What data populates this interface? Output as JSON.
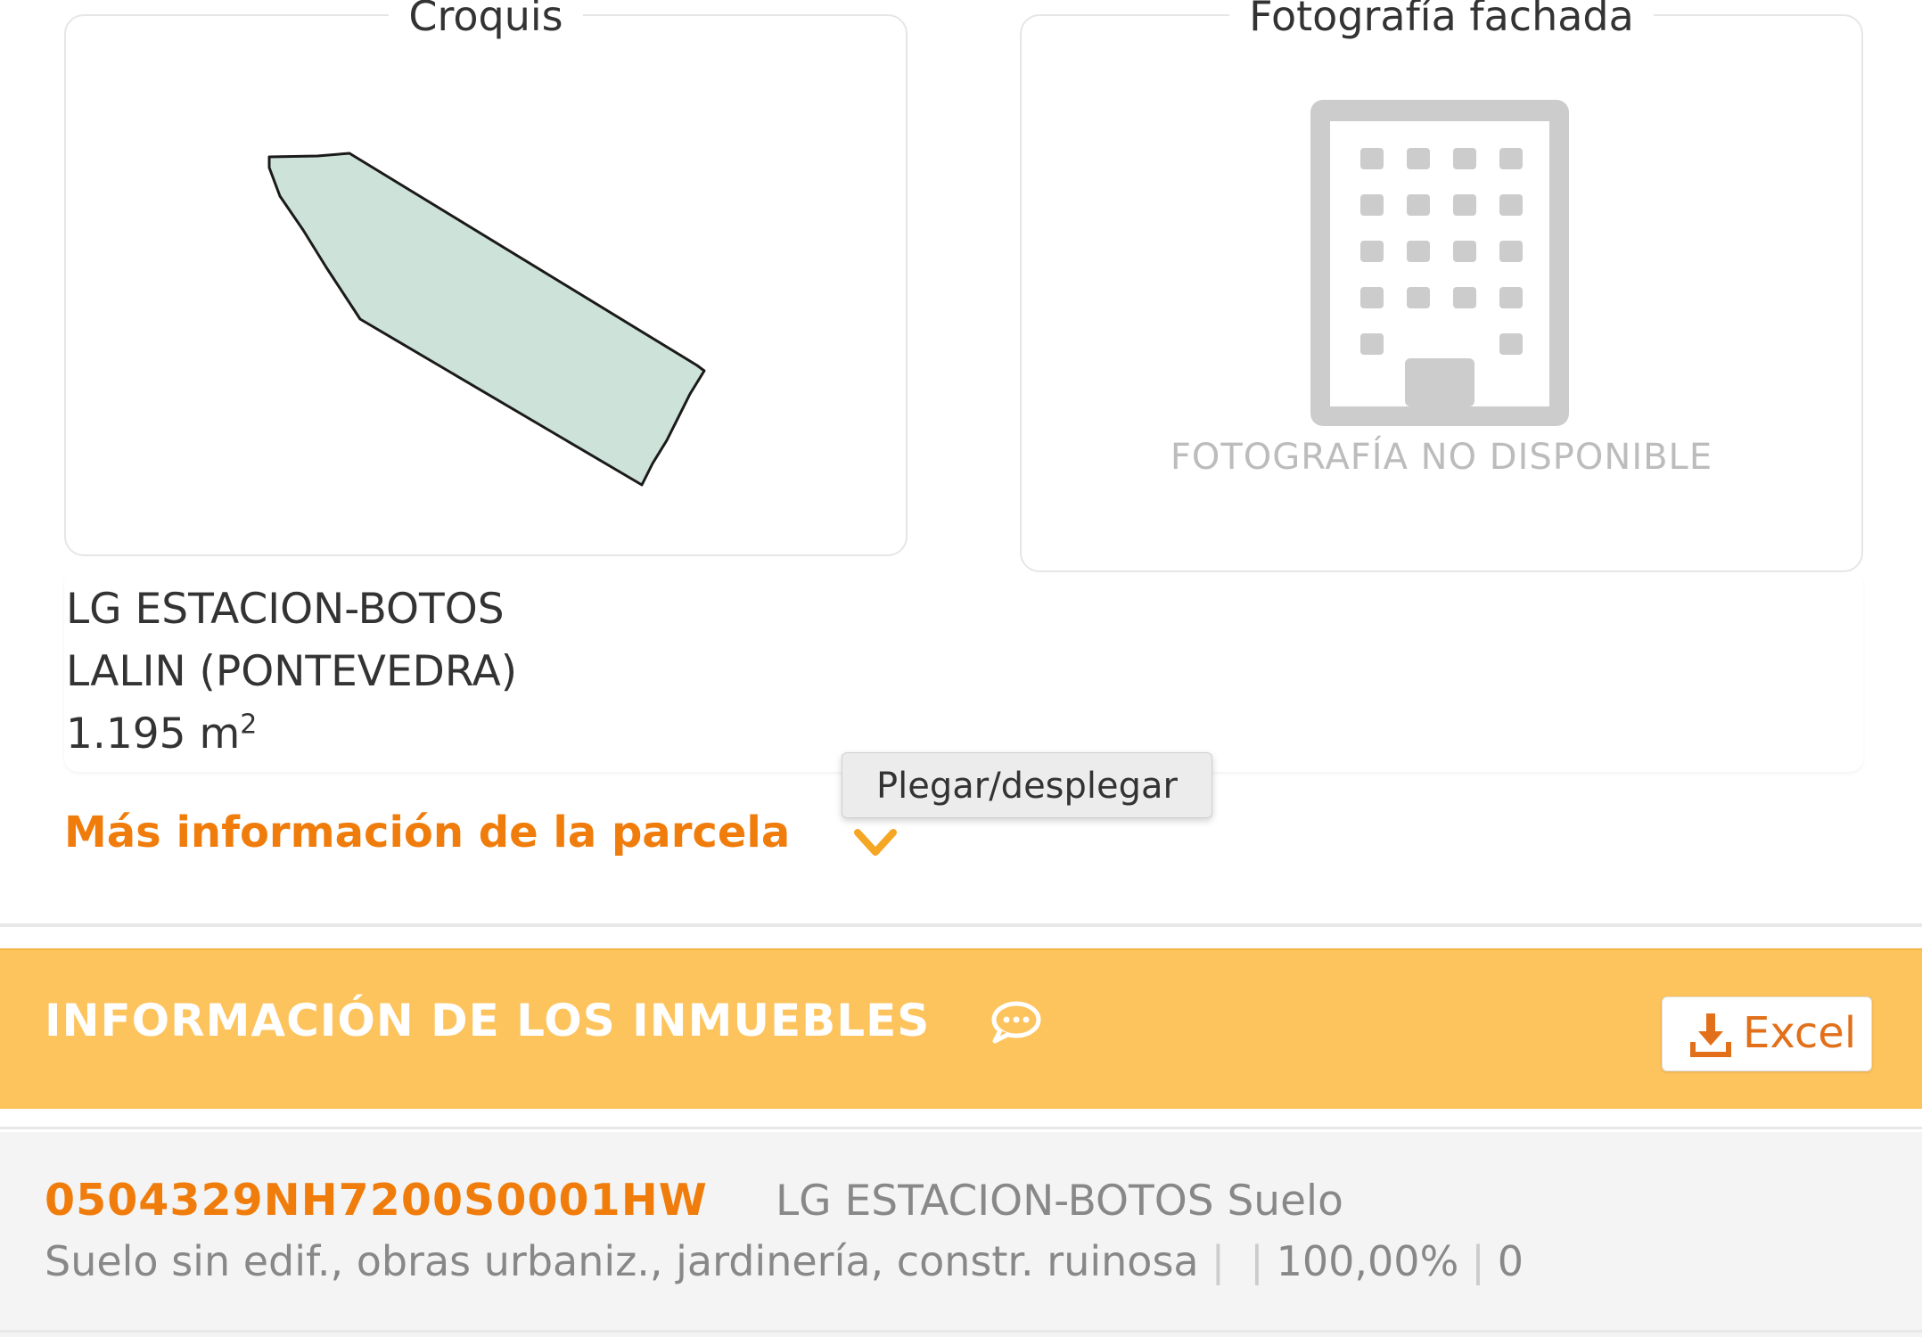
{
  "croquis": {
    "legend": "Croquis",
    "parcel_fill": "#cde2d8",
    "parcel_stroke": "#1a1a1a"
  },
  "fachada": {
    "legend": "Fotografía fachada",
    "no_photo_text": "FOTOGRAFÍA NO DISPONIBLE",
    "icon": "building-icon",
    "icon_color": "#cccccc"
  },
  "parcel": {
    "address_line1": "LG ESTACION-BOTOS",
    "address_line2": "LALIN (PONTEVEDRA)",
    "area_value": "1.195 m",
    "area_unit_sup": "2"
  },
  "more_info": {
    "label": "Más información de la parcela",
    "toggle_icon": "chevron-down-icon",
    "tooltip": "Plegar/desplegar"
  },
  "inmuebles": {
    "title": "INFORMACIÓN DE LOS INMUEBLES",
    "title_icon": "comment-icon",
    "excel_label": "Excel",
    "excel_icon": "download-icon",
    "band_color": "#fdc35c",
    "accent_color": "#f07c0c"
  },
  "properties": [
    {
      "reference": "0504329NH7200S0001HW",
      "address": "LG ESTACION-BOTOS Suelo",
      "use": "Suelo sin edif., obras urbaniz., jardinería, constr. ruinosa",
      "sep1": "|",
      "sep2": "|",
      "participation": "100,00%",
      "sep3": "|",
      "year": "0"
    }
  ]
}
